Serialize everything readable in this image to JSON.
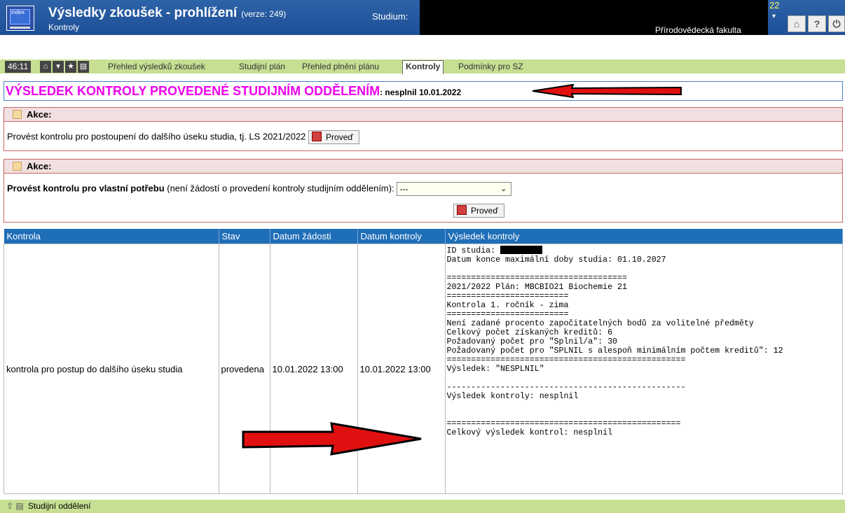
{
  "header": {
    "logo_text": "index",
    "title": "Výsledky zkoušek - prohlížení",
    "version": "(verze: 249)",
    "subtitle": "Kontroly",
    "studium_label": "Studium:",
    "year_fragment": "22",
    "faculty": "Přírodovědecká fakulta"
  },
  "nav": {
    "timer": "46:11",
    "tabs": [
      "Přehled výsledků zkoušek",
      "Studijní plán",
      "Přehled plnění plánu",
      "Kontroly",
      "Podmínky pro SZ"
    ],
    "active_tab": "Kontroly"
  },
  "banner": {
    "heading": "VÝSLEDEK KONTROLY PROVEDENÉ STUDIJNÍM ODDĚLENÍM",
    "result": ": nesplnil 10.01.2022"
  },
  "action1": {
    "title": "Akce:",
    "text": "Provést kontrolu pro postoupení do dalšího úseku studia, tj. LS 2021/2022",
    "button": "Proveď"
  },
  "action2": {
    "title": "Akce:",
    "text_bold": "Provést kontrolu pro vlastní potřebu",
    "text_rest": " (není žádostí o provedení kontroly studijním oddělením):",
    "select_value": "---",
    "button": "Proveď"
  },
  "table": {
    "headers": [
      "Kontrola",
      "Stav",
      "Datum žádosti",
      "Datum kontroly",
      "Výsledek kontroly"
    ],
    "row": {
      "kontrola": "kontrola pro postup do dalšího úseku studia",
      "stav": "provedena",
      "datum_zadosti": "10.01.2022 13:00",
      "datum_kontroly": "10.01.2022 13:00",
      "result_id_label": "ID studia: ",
      "result_text": "Datum konce maximální doby studia: 01.10.2027\n\n=====================================\n2021/2022 Plán: MBCBIO21 Biochemie 21\n=========================\nKontrola 1. ročník - zima\n=========================\nNení zadané procento započitatelných bodů za volitelné předměty\nCelkový počet získaných kreditů: 6\nPožadovaný počet pro \"Splnil/a\": 30\nPožadovaný počet pro \"SPLNIL s alespoň minimálním počtem kreditů\": 12\n=================================================\nVýsledek: \"NESPLNIL\"\n\n-------------------------------------------------\nVýsledek kontroly: nesplnil\n\n\n================================================\nCelkový výsledek kontrol: nesplnil\n"
    }
  },
  "footer": {
    "text": "Studijní oddělení"
  },
  "colors": {
    "header_bg": "#1d4f96",
    "nav_bg": "#c6df93",
    "banner_text": "#ee00ee",
    "table_header": "#1f6eb8",
    "arrow": "#e01010"
  }
}
